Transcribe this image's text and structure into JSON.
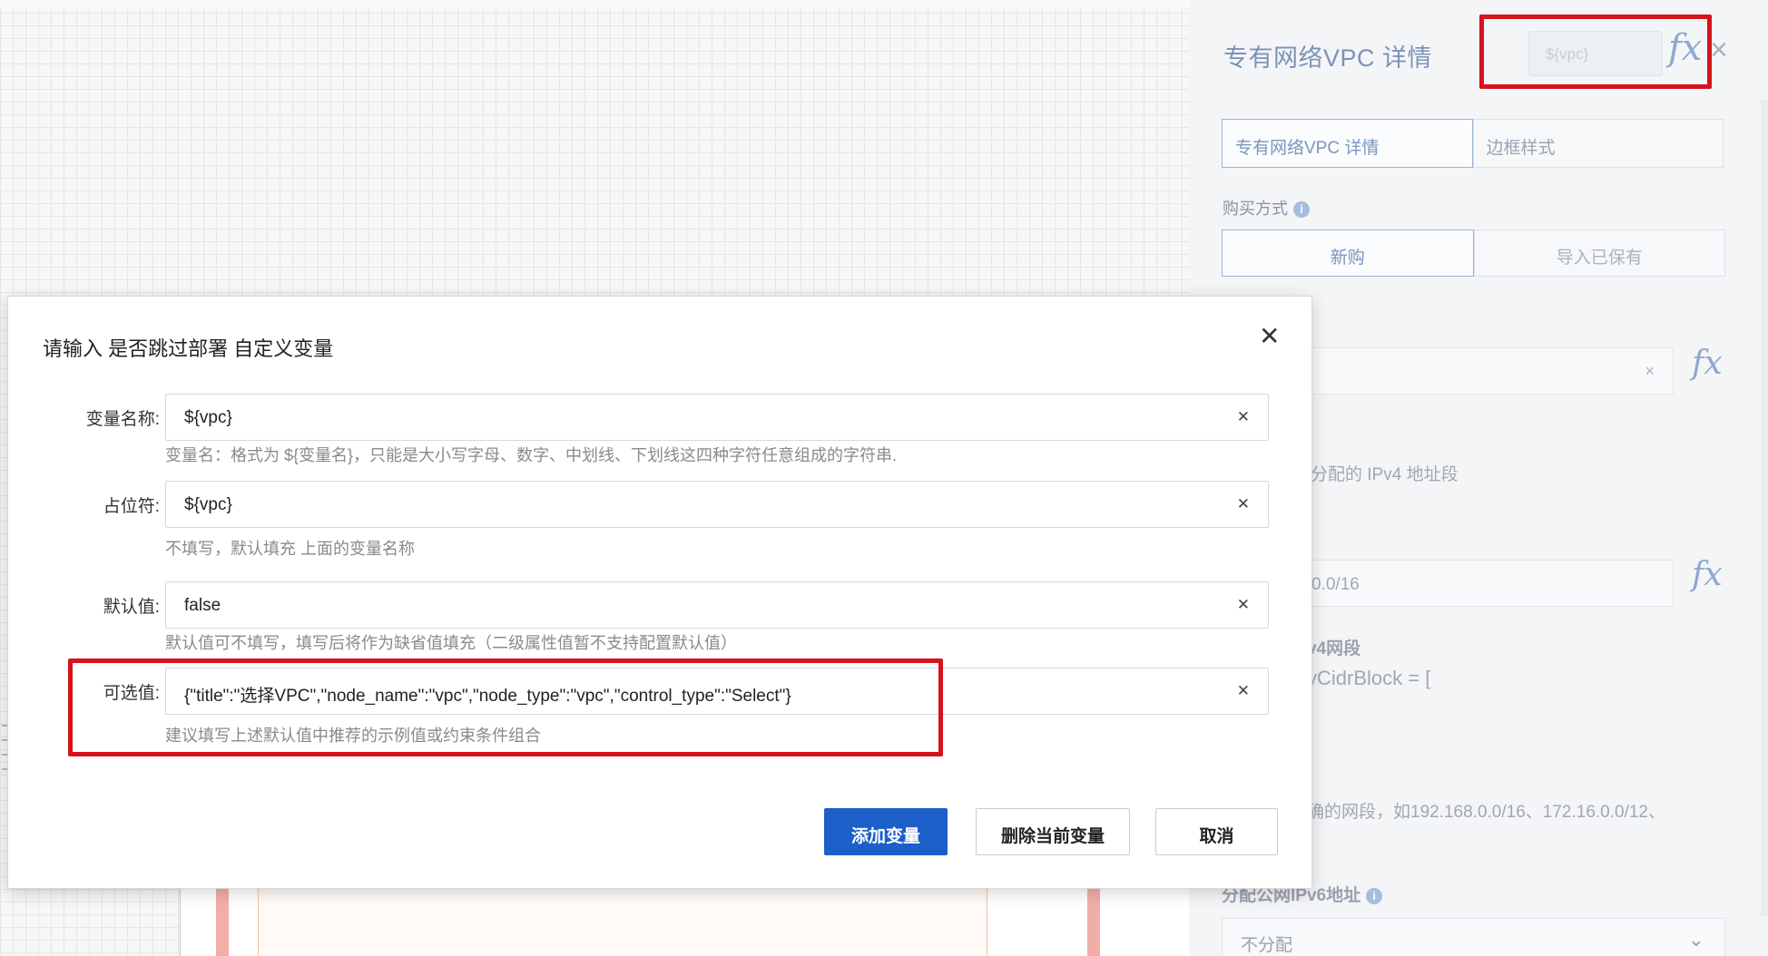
{
  "detail_panel": {
    "title": "专有网络VPC 详情",
    "fx_placeholder": "${vpc}",
    "fx_symbol": "fx",
    "tabs": [
      "专有网络VPC 详情",
      "边框样式"
    ],
    "purchase_label": "购买方式",
    "purchase_options": [
      "新购",
      "导入已保有"
    ],
    "ipv4_text": "分配的 IPv4 地址段",
    "cidr_value": "0.0/16",
    "ipv4_segment_label": "v4网段",
    "cidr_block_text": "yCidrBlock = [",
    "cidr_hint": "确的网段，如192.168.0.0/16、172.16.0.0/12、",
    "ipv6_label": "分配公网IPv6地址",
    "ipv6_select": "不分配"
  },
  "dialog": {
    "title": "请输入 是否跳过部署 自定义变量",
    "fields": [
      {
        "label": "变量名称:",
        "value": "${vpc}",
        "hint": "变量名：格式为 ${变量名}，只能是大小写字母、数字、中划线、下划线这四种字符任意组成的字符串."
      },
      {
        "label": "占位符:",
        "value": "${vpc}",
        "hint": "不填写，默认填充 上面的变量名称"
      },
      {
        "label": "默认值:",
        "value": "false",
        "hint": "默认值可不填写，填写后将作为缺省值填充（二级属性值暂不支持配置默认值）"
      },
      {
        "label": "可选值:",
        "value": "{\"title\":\"选择VPC\",\"node_name\":\"vpc\",\"node_type\":\"vpc\",\"control_type\":\"Select\"}",
        "hint": "建议填写上述默认值中推荐的示例值或约束条件组合"
      }
    ],
    "buttons": {
      "add": "添加变量",
      "delete": "删除当前变量",
      "cancel": "取消"
    }
  },
  "colors": {
    "primary_button": "#1c5fc9",
    "highlight_frame": "#d6121d"
  },
  "icons": {
    "dialog_close": "close-icon",
    "field_clear": "clear-icon",
    "info": "info-icon",
    "formula": "fx-icon",
    "select_arrow": "chevron-down-icon"
  }
}
